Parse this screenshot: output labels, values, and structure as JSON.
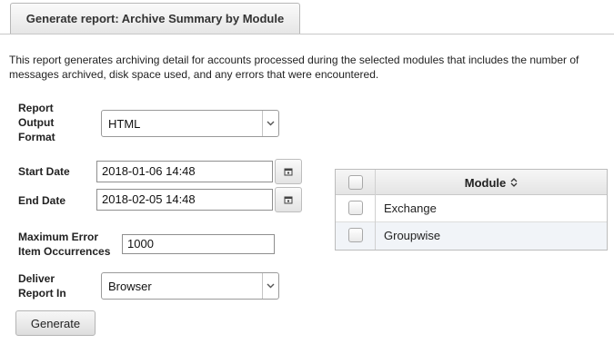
{
  "tab": {
    "title": "Generate report: Archive Summary by Module"
  },
  "description": "This report generates archiving detail for accounts processed during the selected modules that includes the number of messages archived, disk space used, and any errors that were encountered.",
  "form": {
    "output_format": {
      "label_lines": [
        "Report",
        "Output",
        "Format"
      ],
      "value": "HTML"
    },
    "start_date": {
      "label": "Start Date",
      "value": "2018-01-06 14:48"
    },
    "end_date": {
      "label": "End Date",
      "value": "2018-02-05 14:48"
    },
    "max_errors": {
      "label_lines": [
        "Maximum Error",
        "Item Occurrences"
      ],
      "value": "1000"
    },
    "deliver": {
      "label_lines": [
        "Deliver",
        "Report In"
      ],
      "value": "Browser"
    },
    "generate_label": "Generate"
  },
  "module_table": {
    "header": "Module",
    "rows": [
      {
        "name": "Exchange"
      },
      {
        "name": "Groupwise"
      }
    ]
  },
  "icons": {
    "dropdown": "chevron-down-icon",
    "calendar": "calendar-icon",
    "sort": "sort-icon"
  },
  "colors": {
    "alt_row": "#f1f4f8",
    "border": "#bcbcbc"
  }
}
